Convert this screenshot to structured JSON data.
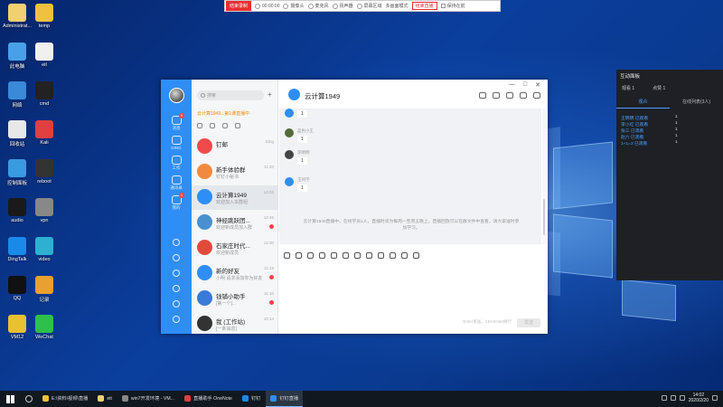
{
  "recording_bar": {
    "record_label": "结束录制",
    "timer": "00:00:00",
    "items": [
      "摄像头",
      "麦克风",
      "扬声器",
      "屏幕区域"
    ],
    "mode": "多画面模式",
    "end_label": "结束直播",
    "keep_window": "保持在前"
  },
  "desktop_icons": [
    {
      "label": "Administrat...",
      "color": "#f0d070"
    },
    {
      "label": "temp",
      "color": "#f0c040"
    },
    {
      "label": "此电脑",
      "color": "#4aa0e8"
    },
    {
      "label": "eit",
      "color": "#f0f0f0"
    },
    {
      "label": "网络",
      "color": "#3a8ad8"
    },
    {
      "label": "cmd",
      "color": "#222"
    },
    {
      "label": "回收站",
      "color": "#e8e8e8"
    },
    {
      "label": "Kali",
      "color": "#e04040"
    },
    {
      "label": "控制面板",
      "color": "#3a9ae0"
    },
    {
      "label": "reboot",
      "color": "#333"
    },
    {
      "label": "audio",
      "color": "#1a1a1a"
    },
    {
      "label": "vpn",
      "color": "#888"
    },
    {
      "label": "DingTalk",
      "color": "#1a8ae8"
    },
    {
      "label": "video",
      "color": "#30b0d0"
    },
    {
      "label": "QQ",
      "color": "#111"
    },
    {
      "label": "记录",
      "color": "#e8a030"
    },
    {
      "label": "VM12",
      "color": "#e8c030"
    },
    {
      "label": "WeChat",
      "color": "#2ec04a"
    }
  ],
  "dingtalk": {
    "nav": [
      {
        "label": "消息",
        "badge": "9"
      },
      {
        "label": "DING",
        "badge": ""
      },
      {
        "label": "工作",
        "badge": ""
      },
      {
        "label": "通讯录",
        "badge": ""
      },
      {
        "label": "我的",
        "badge": "1"
      }
    ],
    "search_placeholder": "搜索",
    "notice": "云计算1949...第1课直播中",
    "conversations": [
      {
        "name": "钉邮",
        "preview": "",
        "time": "Ding",
        "color": "#f04a4a",
        "unread": false
      },
      {
        "name": "新手体验群",
        "preview": "钉钉小秘书",
        "time": "11:20",
        "color": "#f08a40",
        "unread": false
      },
      {
        "name": "云计算1949",
        "preview": "欢迎加入本群组",
        "time": "14:02",
        "color": "#2f8ef5",
        "unread": false
      },
      {
        "name": "神经跳跃团...",
        "preview": "欢迎新成员加入群",
        "time": "12:45",
        "color": "#4a90d0",
        "unread": true
      },
      {
        "name": "石家庄时代...",
        "preview": "欢迎新成员",
        "time": "12:30",
        "color": "#e04a3a",
        "unread": false
      },
      {
        "name": "新的好友",
        "preview": "小明 请求添加你为好友",
        "time": "11:19",
        "color": "#2f8ef5",
        "unread": true
      },
      {
        "name": "钱铺小助手",
        "preview": "[第一个]...",
        "time": "11:10",
        "color": "#3a7ad8",
        "unread": true
      },
      {
        "name": "我 (工作站)",
        "preview": "[一条消息]",
        "time": "10:14",
        "color": "#333",
        "unread": false
      }
    ],
    "chat": {
      "title": "云计算1949",
      "window_controls": [
        "—",
        "□",
        "✕"
      ],
      "messages": [
        {
          "sender": "",
          "text": "1",
          "color": "#2f8ef5"
        },
        {
          "sender": "蓝色小王",
          "text": "1",
          "color": "#556b3a"
        },
        {
          "sender": "李明明",
          "text": "1",
          "color": "#444"
        },
        {
          "sender": "王同学",
          "text": "1",
          "color": "#2f8ef5"
        }
      ],
      "system_notice": "云计算1949直播中，在线学员1人，直播时间为每周一至周五晚上。直播回放可以在群文件中查看，请大家准时参加学习。",
      "send_hint": "Enter发送，Ctrl+Enter换行",
      "send_label": "发送"
    }
  },
  "interaction_panel": {
    "title": "互动面板",
    "stats": [
      "观看 1",
      "点赞 1"
    ],
    "tabs": [
      "观众",
      "在线列表(3人)"
    ],
    "rows": [
      {
        "name": "王明明 已观看",
        "value": "1"
      },
      {
        "name": "李小红 已观看",
        "value": "1"
      },
      {
        "name": "张三 已观看",
        "value": "1"
      },
      {
        "name": "赵六 已观看",
        "value": "1"
      },
      {
        "name": "1+1=2 已观看",
        "value": "1"
      }
    ]
  },
  "taskbar": {
    "tasks": [
      {
        "label": "E:\\资料\\视频\\直播",
        "color": "#f0c040",
        "active": false
      },
      {
        "label": "eit",
        "color": "#f0d070",
        "active": false
      },
      {
        "label": "win7开发环境 - VM...",
        "color": "#888",
        "active": false
      },
      {
        "label": "直播助手 OneNote",
        "color": "#e04040",
        "active": false
      },
      {
        "label": "钉钉",
        "color": "#1a8ae8",
        "active": false
      },
      {
        "label": "钉钉直播",
        "color": "#2f8ef5",
        "active": true
      }
    ],
    "time": "14:02",
    "date": "2020/2/20"
  }
}
